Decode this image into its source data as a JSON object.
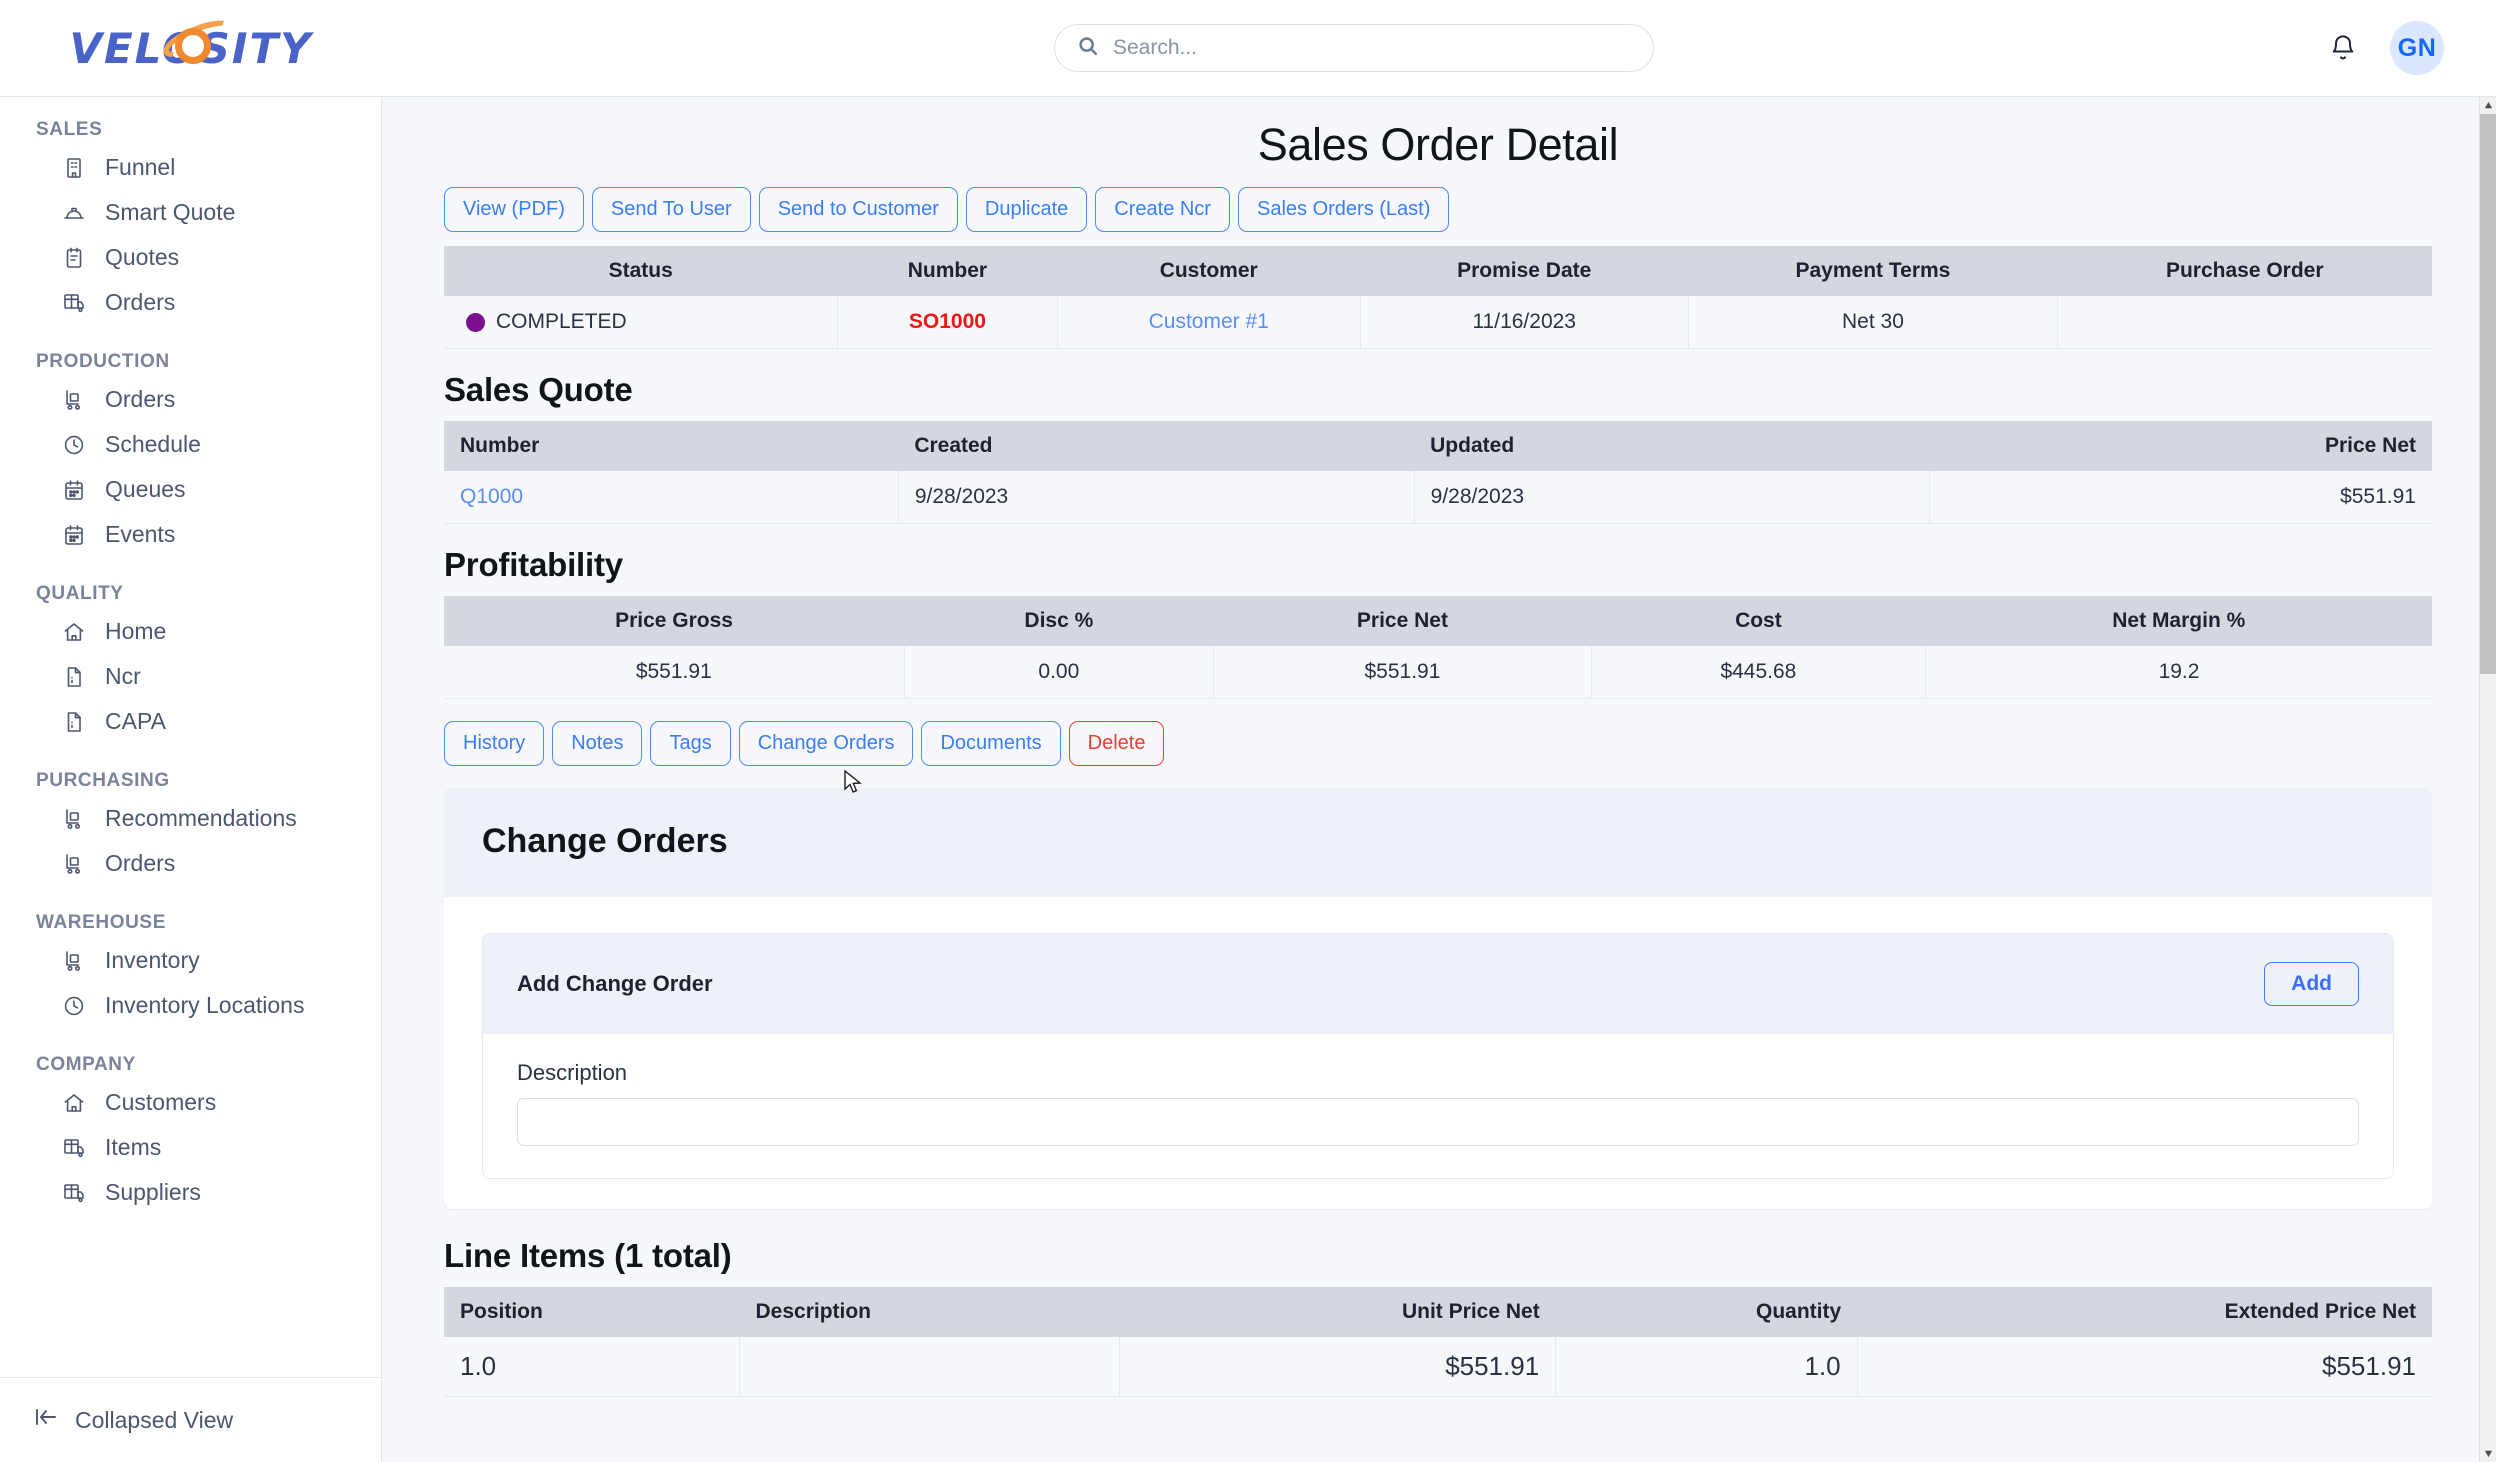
{
  "topbar": {
    "logo_text": "VELOSITY",
    "search": {
      "placeholder": "Search...",
      "value": ""
    },
    "bell_icon": "bell-icon",
    "avatar_initials": "GN"
  },
  "sidebar": {
    "groups": [
      {
        "title": "SALES",
        "items": [
          {
            "label": "Funnel",
            "icon": "building-icon"
          },
          {
            "label": "Smart Quote",
            "icon": "hardhat-icon"
          },
          {
            "label": "Quotes",
            "icon": "clipboard-icon"
          },
          {
            "label": "Orders",
            "icon": "grid-truck-icon"
          }
        ]
      },
      {
        "title": "PRODUCTION",
        "items": [
          {
            "label": "Orders",
            "icon": "handtruck-icon"
          },
          {
            "label": "Schedule",
            "icon": "clock-icon"
          },
          {
            "label": "Queues",
            "icon": "calendar-icon"
          },
          {
            "label": "Events",
            "icon": "calendar-icon"
          }
        ]
      },
      {
        "title": "QUALITY",
        "items": [
          {
            "label": "Home",
            "icon": "home-icon"
          },
          {
            "label": "Ncr",
            "icon": "document-icon"
          },
          {
            "label": "CAPA",
            "icon": "document-icon"
          }
        ]
      },
      {
        "title": "PURCHASING",
        "items": [
          {
            "label": "Recommendations",
            "icon": "handtruck-icon"
          },
          {
            "label": "Orders",
            "icon": "handtruck-icon"
          }
        ]
      },
      {
        "title": "WAREHOUSE",
        "items": [
          {
            "label": "Inventory",
            "icon": "handtruck-icon"
          },
          {
            "label": "Inventory Locations",
            "icon": "clock-icon"
          }
        ]
      },
      {
        "title": "COMPANY",
        "items": [
          {
            "label": "Customers",
            "icon": "home-icon"
          },
          {
            "label": "Items",
            "icon": "grid-truck-icon"
          },
          {
            "label": "Suppliers",
            "icon": "grid-truck-icon"
          }
        ]
      }
    ],
    "footer": {
      "label": "Collapsed View",
      "icon": "collapse-left-icon"
    }
  },
  "main": {
    "page_title": "Sales Order Detail",
    "top_actions": [
      "View (PDF)",
      "Send To User",
      "Send to Customer",
      "Duplicate",
      "Create Ncr",
      "Sales Orders (Last)"
    ],
    "order_table": {
      "headers": [
        "Status",
        "Number",
        "Customer",
        "Promise Date",
        "Payment Terms",
        "Purchase Order"
      ],
      "row": {
        "status": "COMPLETED",
        "status_color": "#7c0f8f",
        "number": "SO1000",
        "customer": "Customer #1",
        "promise_date": "11/16/2023",
        "payment_terms": "Net 30",
        "purchase_order": ""
      }
    },
    "sales_quote": {
      "title": "Sales Quote",
      "headers": [
        "Number",
        "Created",
        "Updated",
        "Price Net"
      ],
      "row": {
        "number": "Q1000",
        "created": "9/28/2023",
        "updated": "9/28/2023",
        "price_net": "$551.91"
      }
    },
    "profitability": {
      "title": "Profitability",
      "headers": [
        "Price Gross",
        "Disc %",
        "Price Net",
        "Cost",
        "Net Margin %"
      ],
      "row": {
        "price_gross": "$551.91",
        "disc_pct": "0.00",
        "price_net": "$551.91",
        "cost": "$445.68",
        "net_margin_pct": "19.2"
      }
    },
    "sub_actions": [
      "History",
      "Notes",
      "Tags",
      "Change Orders",
      "Documents"
    ],
    "delete_action": "Delete",
    "change_orders": {
      "title": "Change Orders",
      "add_panel_title": "Add Change Order",
      "add_button": "Add",
      "description_label": "Description",
      "description_value": "",
      "description_placeholder": ""
    },
    "line_items": {
      "title": "Line Items (1 total)",
      "headers": [
        "Position",
        "Description",
        "Unit Price Net",
        "Quantity",
        "Extended Price Net"
      ],
      "rows": [
        {
          "position": "1.0",
          "description": "",
          "unit_price_net": "$551.91",
          "quantity": "1.0",
          "extended_price_net": "$551.91"
        }
      ]
    }
  },
  "colors": {
    "accent_blue": "#3b7df5",
    "link_blue": "#5b8df0",
    "danger_red": "#f03b2e",
    "number_red": "#f01616",
    "status_purple": "#7c0f8f",
    "header_gray": "#d4d7dd",
    "page_bg": "#f7f8fc"
  }
}
